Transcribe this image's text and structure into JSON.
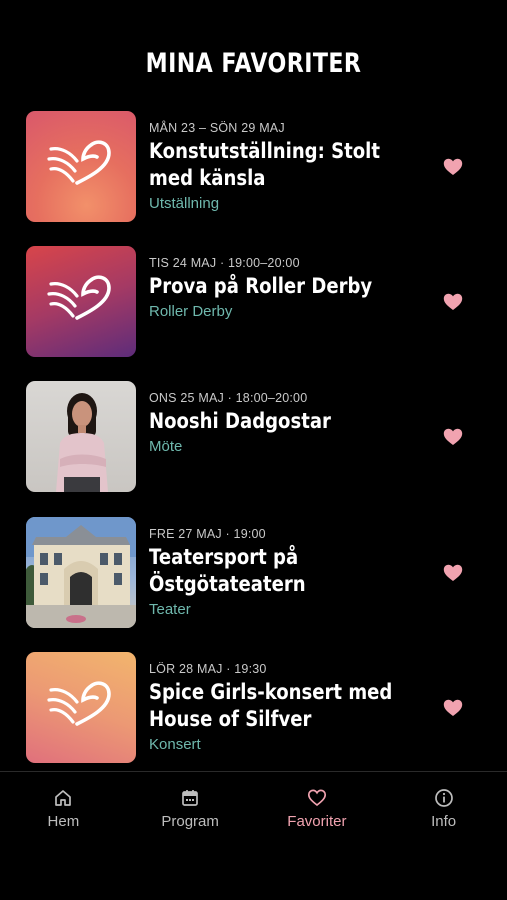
{
  "header": {
    "title": "MINA FAVORITER"
  },
  "colors": {
    "accent": "#f1a3b0",
    "category": "#6fb8ad",
    "heart": "#f1a3b0"
  },
  "events": [
    {
      "date": "MÅN 23 – SÖN 29 MAJ",
      "name": "Konstutställning: Stolt med känsla",
      "category": "Utställning",
      "thumb": "logo"
    },
    {
      "date": "TIS 24 MAJ · 19:00–20:00",
      "name": "Prova på Roller Derby",
      "category": "Roller Derby",
      "thumb": "logo"
    },
    {
      "date": "ONS 25 MAJ · 18:00–20:00",
      "name": "Nooshi Dadgostar",
      "category": "Möte",
      "thumb": "photo"
    },
    {
      "date": "FRE 27 MAJ · 19:00",
      "name": "Teatersport på Östgötateatern",
      "category": "Teater",
      "thumb": "photo"
    },
    {
      "date": "LÖR 28 MAJ · 19:30",
      "name": "Spice Girls-konsert med House of Silfver",
      "category": "Konsert",
      "thumb": "logo"
    }
  ],
  "tabs": [
    {
      "label": "Hem",
      "icon": "home-icon"
    },
    {
      "label": "Program",
      "icon": "calendar-icon"
    },
    {
      "label": "Favoriter",
      "icon": "heart-icon",
      "active": true
    },
    {
      "label": "Info",
      "icon": "info-icon"
    }
  ]
}
